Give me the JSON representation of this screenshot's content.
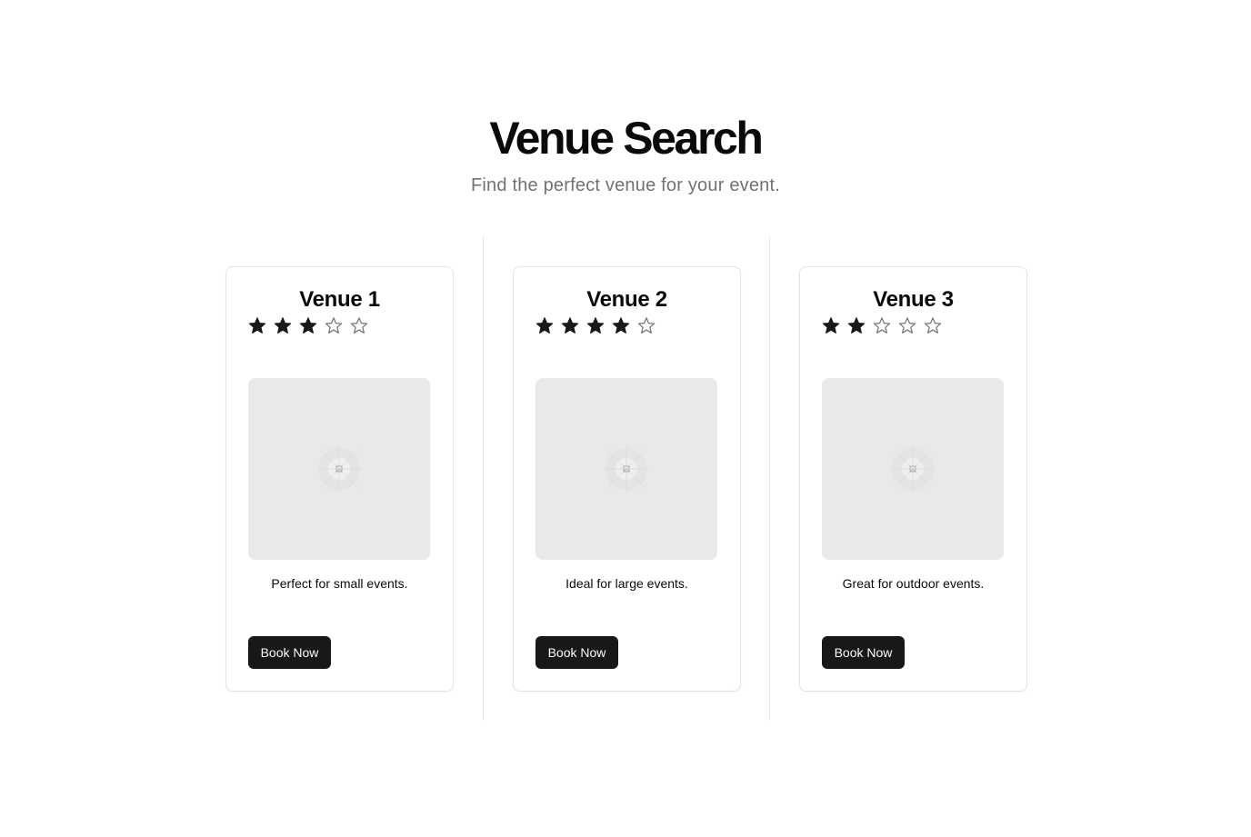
{
  "header": {
    "title": "Venue Search",
    "subtitle": "Find the perfect venue for your event."
  },
  "colors": {
    "star_filled": "#18181b",
    "star_empty_stroke": "#71717a",
    "button_bg": "#18181b",
    "button_text": "#fafafa",
    "placeholder_bg": "#e9e9e9",
    "subtitle": "#71717a",
    "border": "#e4e4e7"
  },
  "venues": [
    {
      "name": "Venue 1",
      "rating": 3,
      "rating_max": 5,
      "image_icon": "image-placeholder-icon",
      "description": "Perfect for small events.",
      "button_label": "Book Now"
    },
    {
      "name": "Venue 2",
      "rating": 4,
      "rating_max": 5,
      "image_icon": "image-placeholder-icon",
      "description": "Ideal for large events.",
      "button_label": "Book Now"
    },
    {
      "name": "Venue 3",
      "rating": 2,
      "rating_max": 5,
      "image_icon": "image-placeholder-icon",
      "description": "Great for outdoor events.",
      "button_label": "Book Now"
    }
  ]
}
